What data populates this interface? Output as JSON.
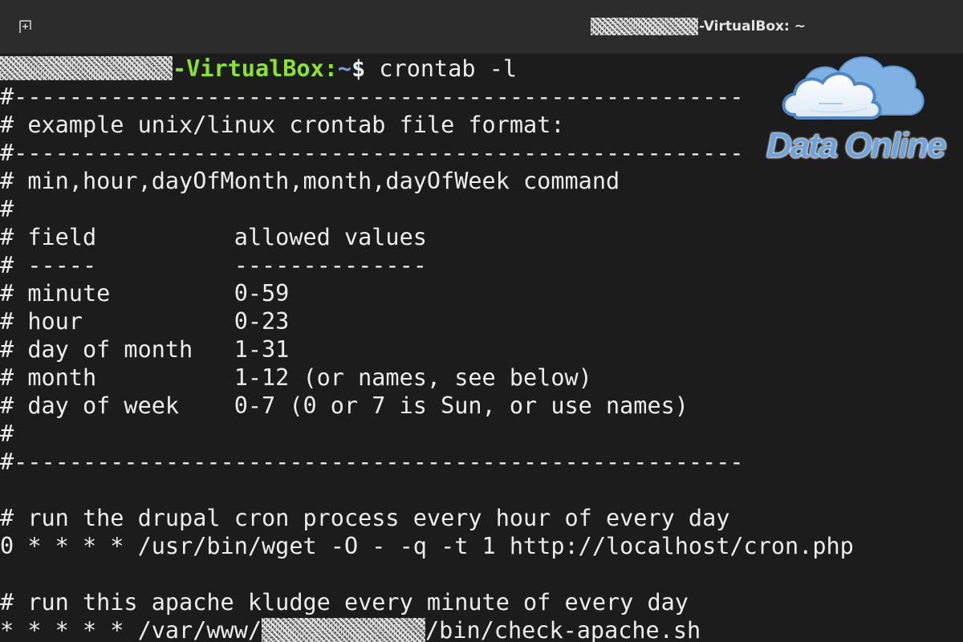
{
  "window": {
    "title_suffix": "-VirtualBox: ~"
  },
  "prompt": {
    "host_suffix": "-VirtualBox",
    "separator": ":",
    "path": "~",
    "symbol": "$",
    "command": " crontab -l"
  },
  "lines": [
    "#-----------------------------------------------------",
    "# example unix/linux crontab file format:",
    "#-----------------------------------------------------",
    "# min,hour,dayOfMonth,month,dayOfWeek command",
    "#",
    "# field          allowed values",
    "# -----          --------------",
    "# minute         0-59",
    "# hour           0-23",
    "# day of month   1-31",
    "# month          1-12 (or names, see below)",
    "# day of week    0-7 (0 or 7 is Sun, or use names)",
    "#",
    "#-----------------------------------------------------",
    "",
    "# run the drupal cron process every hour of every day",
    "0 * * * * /usr/bin/wget -O - -q -t 1 http://localhost/cron.php",
    "",
    "# run this apache kludge every minute of every day"
  ],
  "last_line": {
    "prefix": "* * * * * /var/www/",
    "suffix": "/bin/check-apache.sh"
  },
  "logo": {
    "text": "Data Online"
  },
  "colors": {
    "terminal_bg": "#1c1c1c",
    "titlebar_bg": "#2c2c2c",
    "text": "#ececec",
    "prompt_host": "#8ae234",
    "prompt_path": "#729fcf",
    "logo_blue": "#6fa3dc"
  },
  "icons": {
    "new_tab": "new-tab-icon",
    "logo": "cloud-icon"
  }
}
